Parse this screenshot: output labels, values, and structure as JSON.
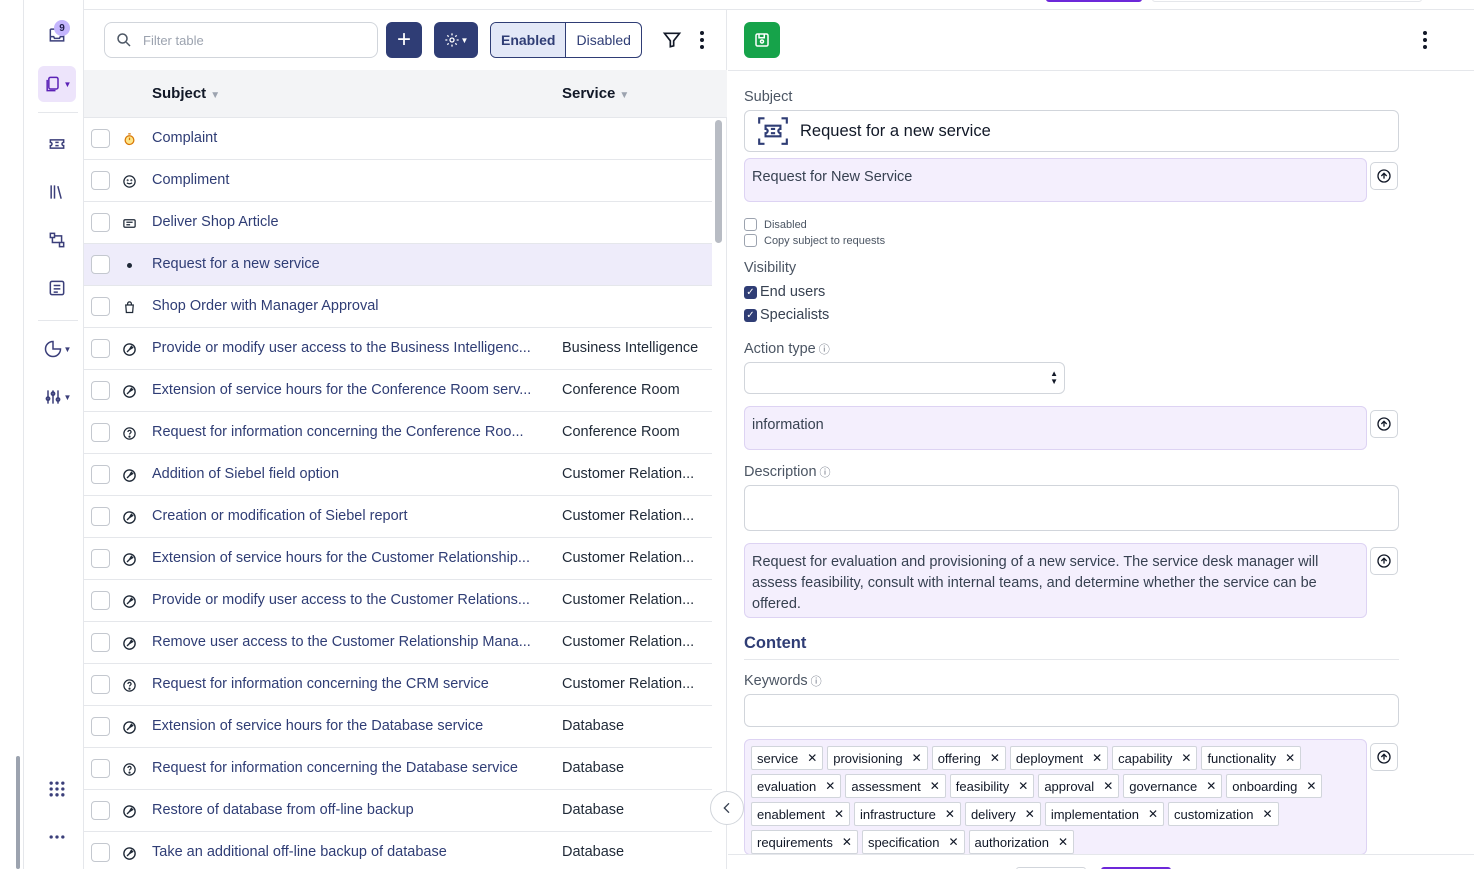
{
  "rail": {
    "inbox_badge": "9",
    "items": [
      "inbox-icon",
      "requests-icon",
      "tickets-icon",
      "library-icon",
      "workflow-icon",
      "list-icon",
      "reports-icon",
      "settings-sliders-icon",
      "apps-grid-icon",
      "more-icon"
    ]
  },
  "toolbar": {
    "filter_placeholder": "Filter table",
    "enabled_label": "Enabled",
    "disabled_label": "Disabled"
  },
  "table": {
    "headers": {
      "subject": "Subject",
      "service": "Service"
    },
    "rows": [
      {
        "subject": "Complaint",
        "service": "",
        "icon": "stopwatch-icon"
      },
      {
        "subject": "Compliment",
        "service": "",
        "icon": "smile-icon"
      },
      {
        "subject": "Deliver Shop Article",
        "service": "",
        "icon": "card-icon"
      },
      {
        "subject": "Request for a new service",
        "service": "",
        "icon": "dot-icon"
      },
      {
        "subject": "Shop Order with Manager Approval",
        "service": "",
        "icon": "bag-icon"
      },
      {
        "subject": "Provide or modify user access to the Business Intelligenc...",
        "service": "Business Intelligence",
        "icon": "request-icon"
      },
      {
        "subject": "Extension of service hours for the Conference Room serv...",
        "service": "Conference Room",
        "icon": "request-icon"
      },
      {
        "subject": "Request for information concerning the Conference Roo...",
        "service": "Conference Room",
        "icon": "question-icon"
      },
      {
        "subject": "Addition of Siebel field option",
        "service": "Customer Relation...",
        "icon": "request-icon"
      },
      {
        "subject": "Creation or modification of Siebel report",
        "service": "Customer Relation...",
        "icon": "request-icon"
      },
      {
        "subject": "Extension of service hours for the Customer Relationship...",
        "service": "Customer Relation...",
        "icon": "request-icon"
      },
      {
        "subject": "Provide or modify user access to the Customer Relations...",
        "service": "Customer Relation...",
        "icon": "request-icon"
      },
      {
        "subject": "Remove user access to the Customer Relationship Mana...",
        "service": "Customer Relation...",
        "icon": "request-icon"
      },
      {
        "subject": "Request for information concerning the CRM service",
        "service": "Customer Relation...",
        "icon": "question-icon"
      },
      {
        "subject": "Extension of service hours for the Database service",
        "service": "Database",
        "icon": "request-icon"
      },
      {
        "subject": "Request for information concerning the Database service",
        "service": "Database",
        "icon": "question-icon"
      },
      {
        "subject": "Restore of database from off-line backup",
        "service": "Database",
        "icon": "request-icon"
      },
      {
        "subject": "Take an additional off-line backup of database",
        "service": "Database",
        "icon": "request-icon"
      }
    ]
  },
  "detail": {
    "subject_label": "Subject",
    "subject_value": "Request for a new service",
    "subject_translation": "Request for New Service",
    "disabled_label": "Disabled",
    "copy_subject_label": "Copy subject to requests",
    "visibility_label": "Visibility",
    "end_users_label": "End users",
    "specialists_label": "Specialists",
    "action_type_label": "Action type",
    "action_type_translation": "information",
    "description_label": "Description",
    "description_translation": "Request for evaluation and provisioning of a new service. The service desk manager will assess feasibility, consult with internal teams, and determine whether the service can be offered.",
    "content_heading": "Content",
    "keywords_label": "Keywords",
    "keywords": [
      "service",
      "provisioning",
      "offering",
      "deployment",
      "capability",
      "functionality",
      "evaluation",
      "assessment",
      "feasibility",
      "approval",
      "governance",
      "onboarding",
      "enablement",
      "infrastructure",
      "delivery",
      "implementation",
      "customization",
      "requirements",
      "specification",
      "authorization"
    ]
  },
  "colors": {
    "brand": "#2f3d75",
    "selected_row": "#eeecfa",
    "translation_bg": "#f4effd",
    "save_green": "#16a34a"
  }
}
